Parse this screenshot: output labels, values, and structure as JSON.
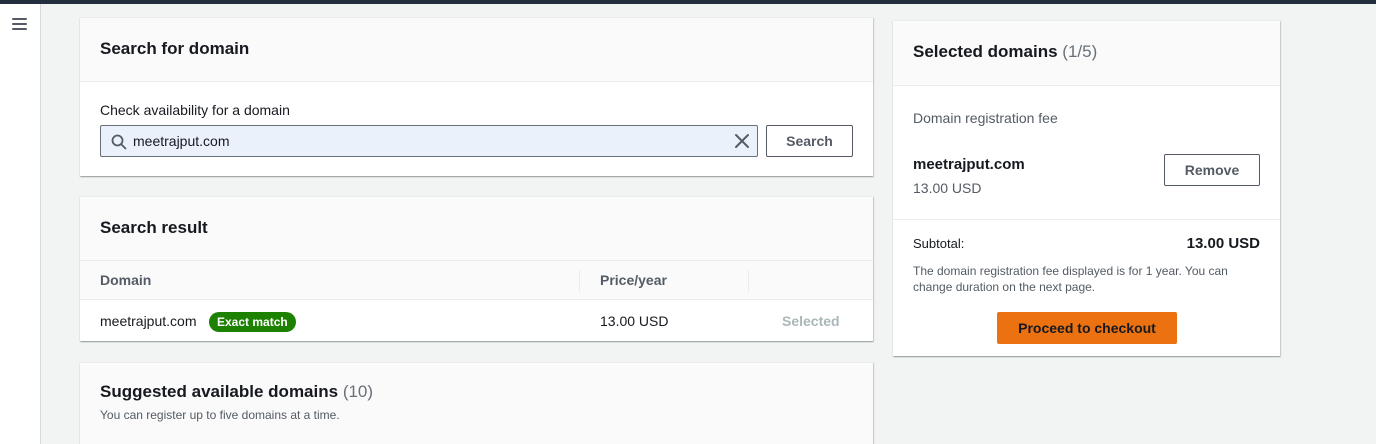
{
  "colors": {
    "topbar": "#232f3e",
    "badge_green": "#1d8102",
    "primary_orange": "#ec7211",
    "input_fill": "#eaf1fb",
    "disabled_text": "#aab7b8"
  },
  "nav": {
    "menu_icon": "hamburger-menu-icon"
  },
  "search": {
    "title": "Search for domain",
    "field_label": "Check availability for a domain",
    "value": "meetrajput.com",
    "search_icon": "search-icon",
    "clear_icon": "close-icon",
    "button_label": "Search"
  },
  "results": {
    "title": "Search result",
    "columns": [
      "Domain",
      "Price/year"
    ],
    "rows": [
      {
        "domain": "meetrajput.com",
        "badge": "Exact match",
        "price": "13.00 USD",
        "status": "Selected"
      }
    ]
  },
  "suggested": {
    "title": "Suggested available domains",
    "count": "(10)",
    "subtitle": "You can register up to five domains at a time."
  },
  "selected": {
    "title": "Selected domains",
    "count": "(1/5)",
    "fee_label": "Domain registration fee",
    "domain": "meetrajput.com",
    "price": "13.00 USD",
    "remove_label": "Remove",
    "subtotal_label": "Subtotal:",
    "subtotal_value": "13.00 USD",
    "note": "The domain registration fee displayed is for 1 year. You can change duration on the next page.",
    "checkout_label": "Proceed to checkout"
  }
}
